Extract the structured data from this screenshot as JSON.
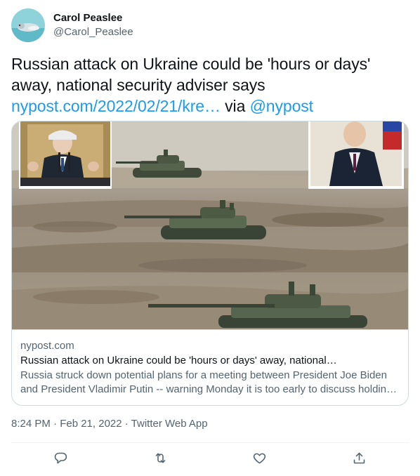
{
  "user": {
    "display_name": "Carol Peaslee",
    "handle": "@Carol_Peaslee"
  },
  "tweet": {
    "text": "Russian attack on Ukraine could be 'hours or days' away, national security adviser says",
    "link_text": "nypost.com/2022/02/21/kre…",
    "via_text": "via",
    "mention": "@nypost"
  },
  "card": {
    "domain": "nypost.com",
    "title": "Russian attack on Ukraine could be 'hours or days' away, national…",
    "description": "Russia struck down potential plans for a meeting between President Joe Biden and President Vladimir Putin -- warning Monday it is too early to discuss holdin…"
  },
  "meta": {
    "text": "8:24 PM · Feb 21, 2022 · Twitter Web App"
  },
  "actions": {
    "reply_icon": "reply-icon",
    "retweet_icon": "retweet-icon",
    "like_icon": "heart-icon",
    "share_icon": "share-icon"
  },
  "colors": {
    "link": "#1d9bf0",
    "secondary_text": "#536471",
    "primary_text": "#0f1419",
    "border": "#cfd9de"
  }
}
